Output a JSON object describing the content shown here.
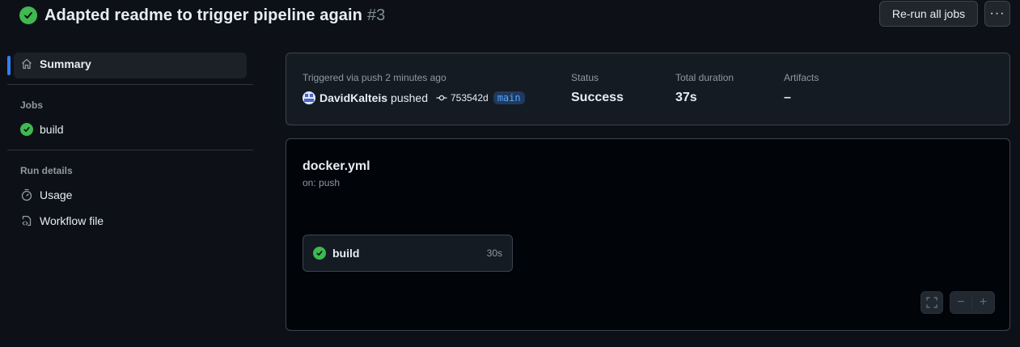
{
  "header": {
    "title": "Adapted readme to trigger pipeline again",
    "run_number": "#3",
    "rerun_label": "Re-run all jobs",
    "more_label": "···"
  },
  "sidebar": {
    "summary_label": "Summary",
    "jobs_heading": "Jobs",
    "jobs": [
      {
        "label": "build",
        "status": "success"
      }
    ],
    "run_details_heading": "Run details",
    "usage_label": "Usage",
    "workflow_file_label": "Workflow file"
  },
  "summary": {
    "triggered_label": "Triggered via push 2 minutes ago",
    "actor": "DavidKalteis",
    "action": "pushed",
    "commit_sha": "753542d",
    "branch": "main",
    "status_label": "Status",
    "status_value": "Success",
    "duration_label": "Total duration",
    "duration_value": "37s",
    "artifacts_label": "Artifacts",
    "artifacts_value": "–"
  },
  "graph": {
    "workflow_name": "docker.yml",
    "trigger": "on: push",
    "jobs": [
      {
        "name": "build",
        "duration": "30s",
        "status": "success"
      }
    ],
    "controls": {
      "zoom_out": "−",
      "zoom_in": "+"
    }
  },
  "colors": {
    "background": "#0d1117",
    "success": "#3fb950",
    "accent": "#2f81f7"
  }
}
